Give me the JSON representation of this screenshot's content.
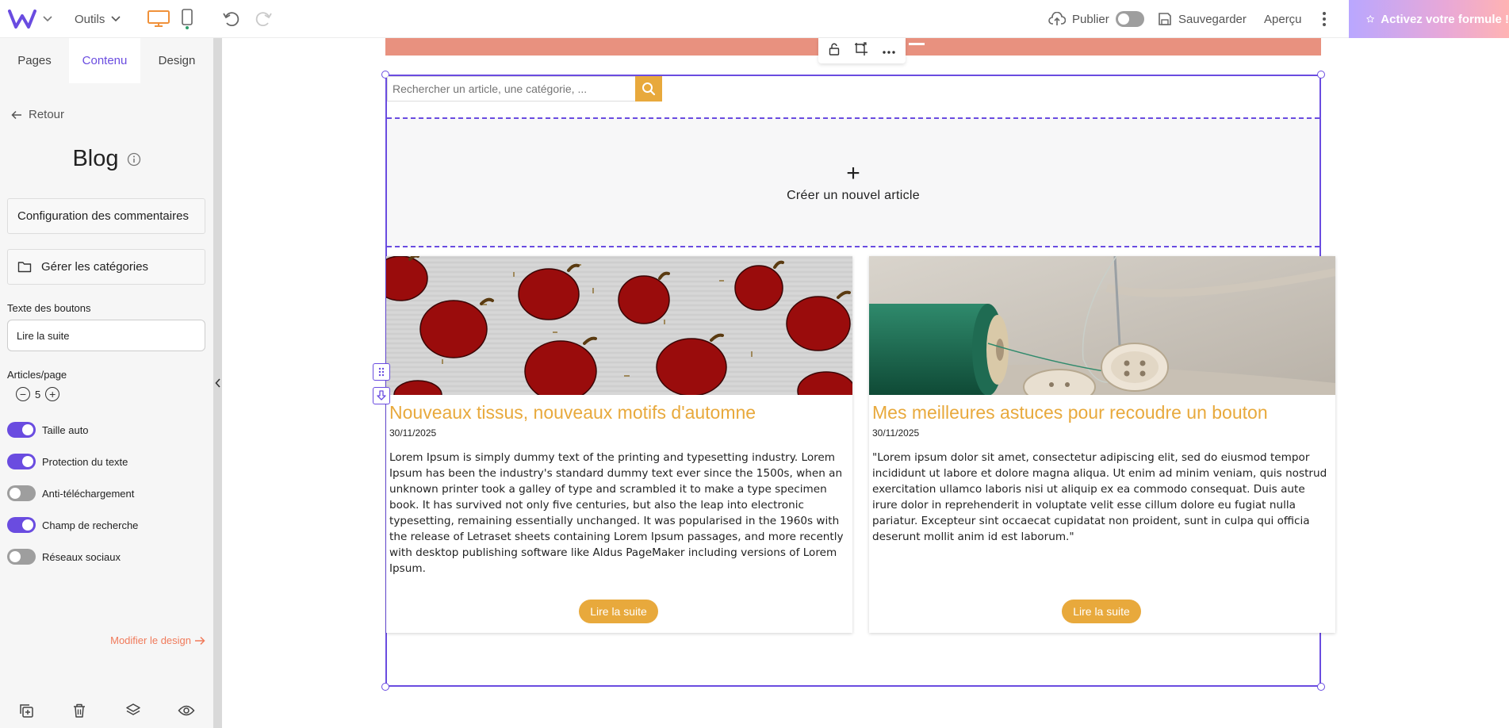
{
  "topbar": {
    "tools_label": "Outils",
    "publish_label": "Publier",
    "save_label": "Sauvegarder",
    "preview_label": "Aperçu",
    "upgrade_label": "Activez votre formule !"
  },
  "sidebar": {
    "tabs": [
      {
        "label": "Pages"
      },
      {
        "label": "Contenu"
      },
      {
        "label": "Design"
      }
    ],
    "back_label": "Retour",
    "title": "Blog",
    "comments_config_label": "Configuration des commentaires",
    "manage_categories_label": "Gérer les catégories",
    "button_text_label": "Texte des boutons",
    "button_text_value": "Lire la suite",
    "articles_per_page_label": "Articles/page",
    "articles_per_page_value": "5",
    "toggles": [
      {
        "label": "Taille auto",
        "on": true
      },
      {
        "label": "Protection du texte",
        "on": true
      },
      {
        "label": "Anti-téléchargement",
        "on": false
      },
      {
        "label": "Champ de recherche",
        "on": true
      },
      {
        "label": "Réseaux sociaux",
        "on": false
      }
    ],
    "modify_design_label": "Modifier le design"
  },
  "canvas": {
    "search_placeholder": "Rechercher un article, une catégorie, ...",
    "create_label": "Créer un nouvel article",
    "articles": [
      {
        "title": "Nouveaux tissus, nouveaux motifs d'automne",
        "date": "30/11/2025",
        "text": "Lorem Ipsum is simply dummy text of the printing and typesetting industry. Lorem Ipsum has been the industry's standard dummy text ever since the 1500s, when an unknown printer took a galley of type and scrambled it to make a type specimen book. It has survived not only five centuries, but also the leap into electronic typesetting, remaining essentially unchanged. It was popularised in the 1960s with the release of Letraset sheets containing Lorem Ipsum passages, and more recently with desktop publishing software like Aldus PageMaker including versions of Lorem Ipsum.",
        "button": "Lire la suite"
      },
      {
        "title": "Mes meilleures astuces pour recoudre un bouton",
        "date": "30/11/2025",
        "text": "\"Lorem ipsum dolor sit amet, consectetur adipiscing elit, sed do eiusmod tempor incididunt ut labore et dolore magna aliqua. Ut enim ad minim veniam, quis nostrud exercitation ullamco laboris nisi ut aliquip ex ea commodo consequat. Duis aute irure dolor in reprehenderit in voluptate velit esse cillum dolore eu fugiat nulla pariatur. Excepteur sint occaecat cupidatat non proident, sunt in culpa qui officia deserunt mollit anim id est laborum.\"",
        "button": "Lire la suite"
      }
    ]
  },
  "colors": {
    "accent": "#6a4ce0",
    "orange": "#e8a93c",
    "salmon": "#e8917f",
    "link": "#f07a5a"
  }
}
